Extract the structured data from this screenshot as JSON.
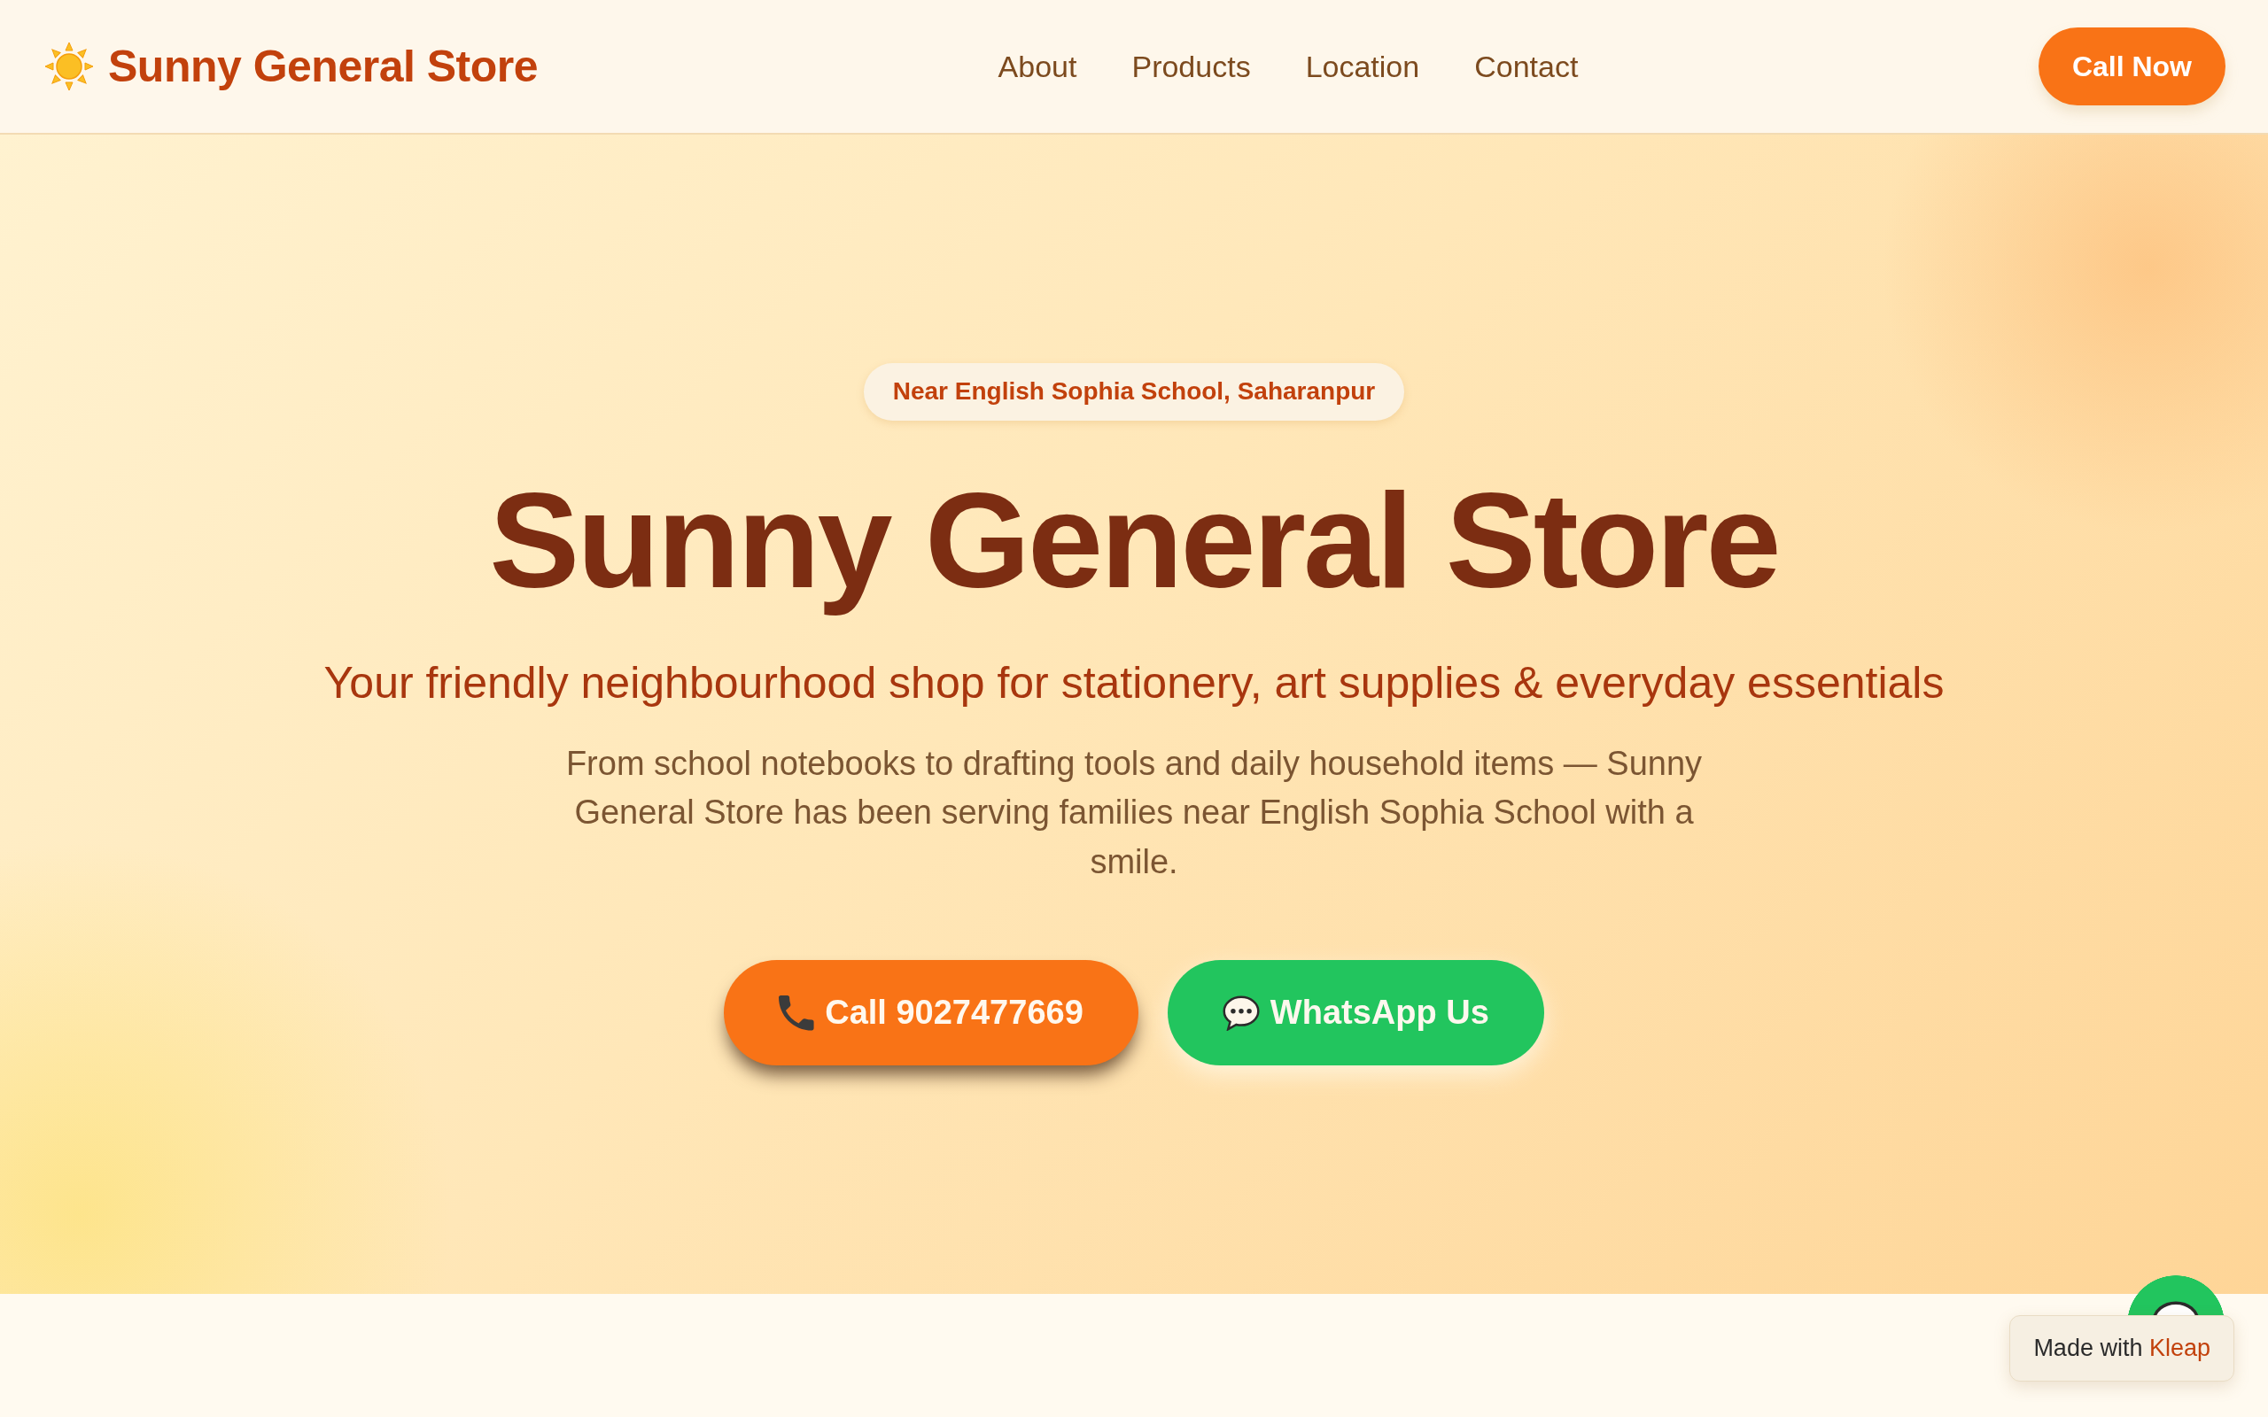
{
  "header": {
    "brand": "Sunny General Store",
    "nav": [
      "About",
      "Products",
      "Location",
      "Contact"
    ],
    "cta": "Call Now"
  },
  "hero": {
    "location_badge": "Near English Sophia School, Saharanpur",
    "title": "Sunny General Store",
    "subtitle": "Your friendly neighbourhood shop for stationery, art supplies & everyday essentials",
    "description": "From school notebooks to drafting tools and daily household items — Sunny General Store has been serving families near English Sophia School with a smile.",
    "buttons": [
      {
        "kind": "call",
        "label": "Call 9027477669"
      },
      {
        "kind": "whatsapp",
        "label": "WhatsApp Us"
      }
    ]
  },
  "builder_badge": {
    "label": "Made with",
    "brand": "Kleap"
  }
}
